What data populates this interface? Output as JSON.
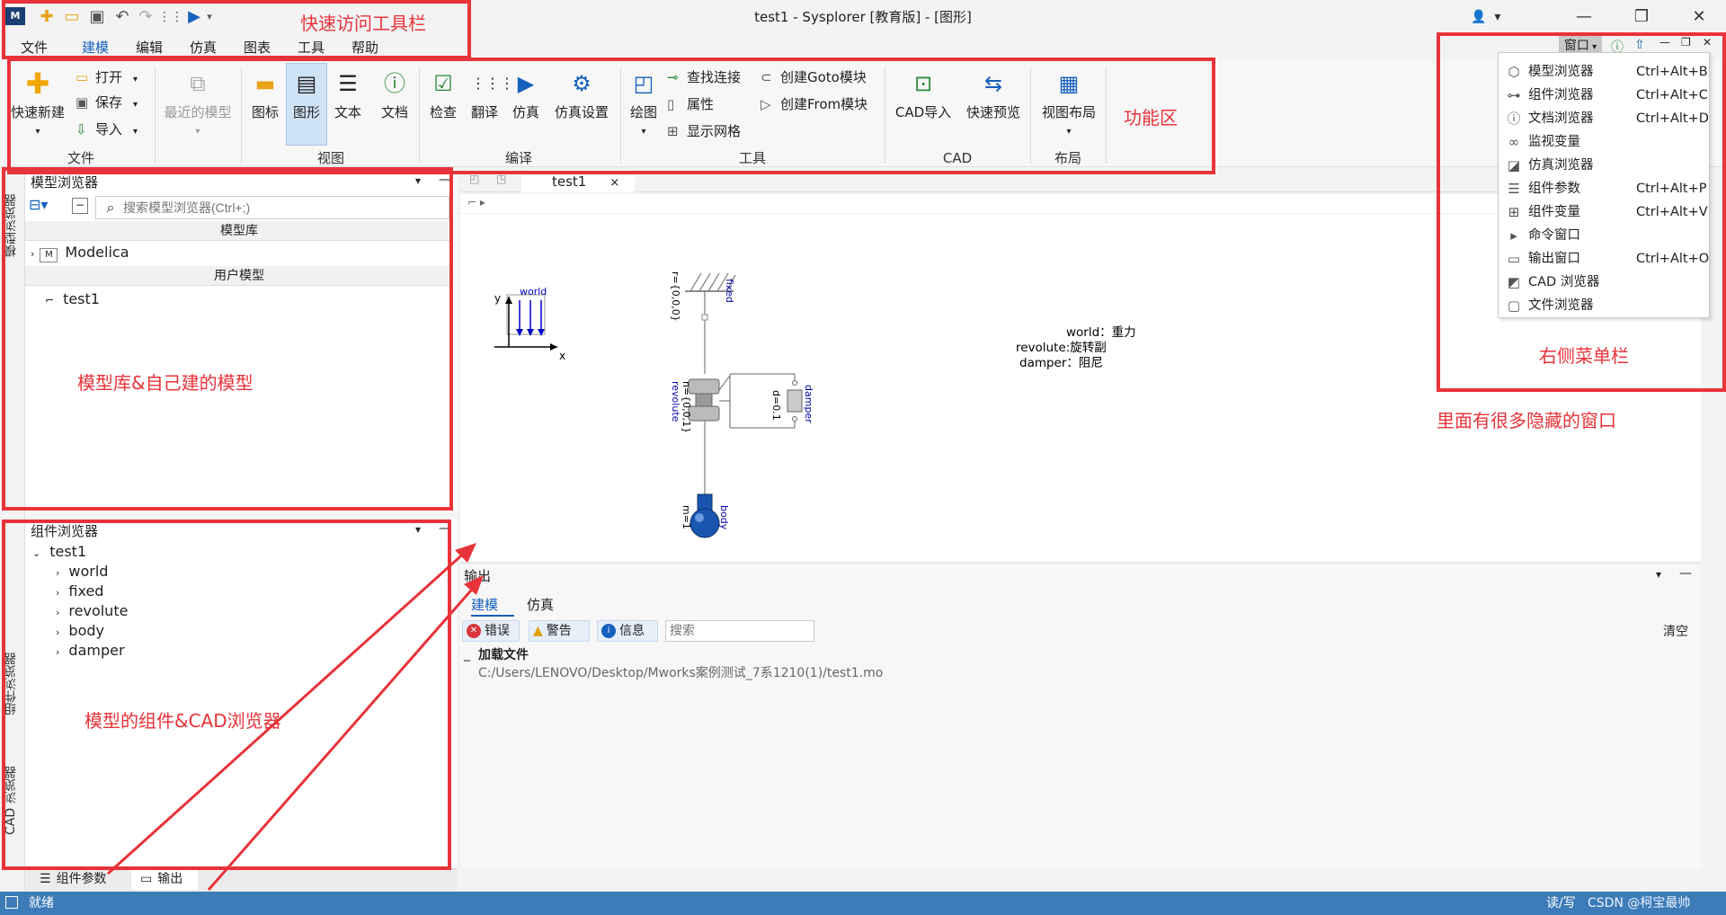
{
  "window": {
    "title": "test1 - Sysplorer [教育版] - [图形]",
    "user_label": "  ▾",
    "controls": {
      "minimize": "—",
      "maximize": "❐",
      "close": "✕"
    }
  },
  "quick_access": {
    "icons": [
      "app-logo-icon",
      "new-icon",
      "open-folder-icon",
      "save-icon",
      "undo-icon",
      "redo-icon",
      "translate-icon",
      "simulate-icon",
      "dropdown-icon"
    ],
    "app_logo_text": "M"
  },
  "menu": {
    "items": [
      "文件",
      "建模",
      "编辑",
      "仿真",
      "图表",
      "工具",
      "帮助"
    ],
    "active_index": 1
  },
  "ribbon": {
    "file": {
      "quick_new": "快速新建",
      "open": "打开",
      "save": "保存",
      "import": "导入",
      "recent": "最近的模型",
      "group": "文件"
    },
    "view": {
      "icon": "图标",
      "diagram": "图形",
      "text": "文本",
      "doc": "文档",
      "group": "视图"
    },
    "compile": {
      "check": "检查",
      "translate": "翻译",
      "simulate": "仿真",
      "sim_settings": "仿真设置",
      "group": "编译"
    },
    "tools": {
      "draw": "绘图",
      "find_connection": "查找连接",
      "properties": "属性",
      "show_grid": "显示网格",
      "create_goto": "创建Goto模块",
      "create_from": "创建From模块",
      "group": "工具"
    },
    "cad": {
      "import": "CAD导入",
      "preview": "快速预览",
      "group": "CAD"
    },
    "layout": {
      "view_layout": "视图布局",
      "group": "布局"
    }
  },
  "annotations": {
    "quick_toolbar": "快速访问工具栏",
    "ribbon_area": "功能区",
    "model_browser_note": "模型库&自己建的模型",
    "component_browser_note": "模型的组件&CAD浏览器",
    "right_menu_note": "右侧菜单栏",
    "hidden_windows_note": "里面有很多隐藏的窗口",
    "accent": "#e8333a"
  },
  "side_tabs": {
    "model_browser": "模型浏览器",
    "component_browser": "组件浏览器",
    "cad_browser": "CAD 浏览器"
  },
  "model_browser": {
    "title": "模型浏览器",
    "search_placeholder": "搜索模型浏览器(Ctrl+;)",
    "library_header": "模型库",
    "library_items": [
      "Modelica"
    ],
    "user_header": "用户模型",
    "user_items": [
      "test1"
    ]
  },
  "component_browser": {
    "title": "组件浏览器",
    "root": "test1",
    "children": [
      "world",
      "fixed",
      "revolute",
      "body",
      "damper"
    ]
  },
  "bottom_tabs": [
    "组件参数",
    "输出"
  ],
  "editor": {
    "tab_label": "test1",
    "tab_close": "×",
    "diagram": {
      "world_label": "world",
      "axis_y": "y",
      "axis_x": "x",
      "fixed_label": "fixed",
      "fixed_param": "r={0,0,0}",
      "revolute_label": "revolute",
      "revolute_param": "n={0,0,1}",
      "damper_label": "damper",
      "damper_param": "d=0.1",
      "body_label": "body",
      "body_param": "m=1",
      "note_lines": [
        "world：重力",
        "revolute:旋转副",
        "damper：阻尼"
      ]
    }
  },
  "output": {
    "title": "输出",
    "tabs": [
      "建模",
      "仿真"
    ],
    "active_tab": 0,
    "filters": {
      "error": "错误",
      "warning": "警告",
      "info": "信息"
    },
    "search_placeholder": "搜索",
    "clear": "清空",
    "entry_title": "加载文件",
    "entry_path": "C:/Users/LENOVO/Desktop/Mworks案例测试_7系1210(1)/test1.mo"
  },
  "window_menu": {
    "label": "窗口",
    "items": [
      {
        "label": "模型浏览器",
        "shortcut": "Ctrl+Alt+B",
        "icon": "cube-icon"
      },
      {
        "label": "组件浏览器",
        "shortcut": "Ctrl+Alt+C",
        "icon": "component-icon"
      },
      {
        "label": "文档浏览器",
        "shortcut": "Ctrl+Alt+D",
        "icon": "info-icon"
      },
      {
        "label": "监视变量",
        "shortcut": "",
        "icon": "glasses-icon"
      },
      {
        "label": "仿真浏览器",
        "shortcut": "",
        "icon": "chart-icon"
      },
      {
        "label": "组件参数",
        "shortcut": "Ctrl+Alt+P",
        "icon": "list-icon"
      },
      {
        "label": "组件变量",
        "shortcut": "Ctrl+Alt+V",
        "icon": "grid-icon"
      },
      {
        "label": "命令窗口",
        "shortcut": "",
        "icon": "terminal-icon"
      },
      {
        "label": "输出窗口",
        "shortcut": "Ctrl+Alt+O",
        "icon": "output-icon"
      },
      {
        "label": "CAD 浏览器",
        "shortcut": "",
        "icon": "cad-icon"
      },
      {
        "label": "文件浏览器",
        "shortcut": "",
        "icon": "folder-icon"
      }
    ]
  },
  "status": {
    "left": "就绪",
    "right": "读/写",
    "watermark": "CSDN @柯宝最帅"
  }
}
